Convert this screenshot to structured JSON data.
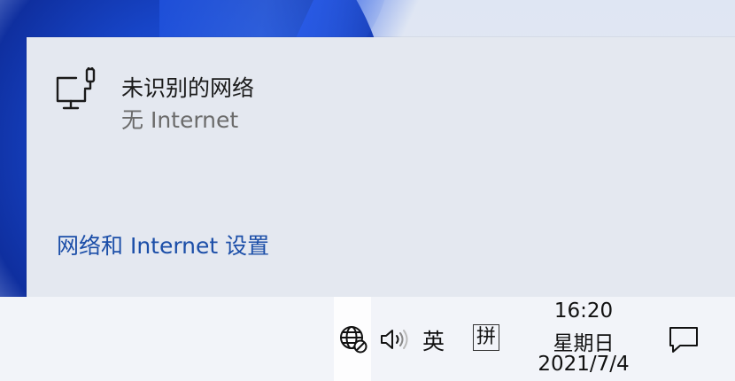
{
  "flyout": {
    "network_name": "未识别的网络",
    "network_status": "无 Internet",
    "settings_link": "网络和 Internet 设置"
  },
  "taskbar": {
    "network_icon": "globe-no-internet-icon",
    "volume_icon": "speaker-icon",
    "ime_language": "英",
    "ime_mode": "拼",
    "clock": {
      "time": "16:20",
      "weekday": "星期日",
      "date": "2021/7/4"
    },
    "notification_icon": "action-center-icon"
  },
  "colors": {
    "link": "#1b4ea8",
    "status_gray": "#6b6b6b",
    "flyout_bg": "#e4e8f0",
    "taskbar_bg": "#f2f4f9"
  }
}
